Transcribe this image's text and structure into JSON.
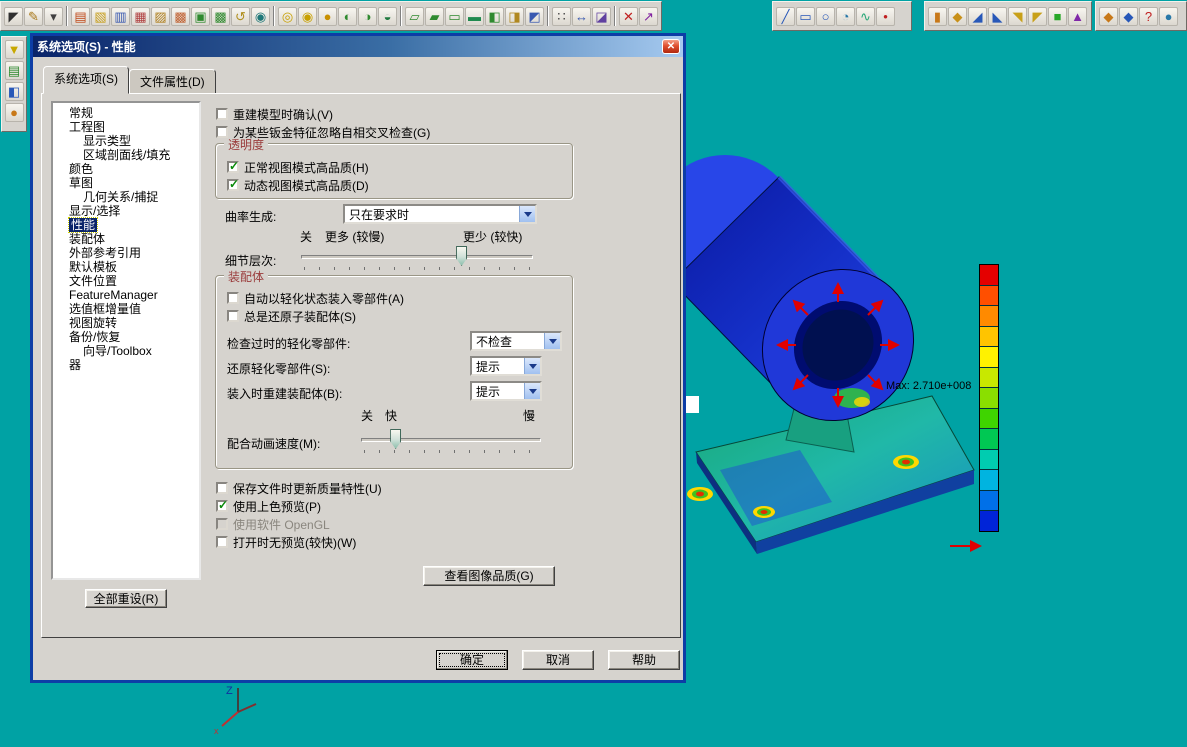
{
  "window": {
    "title": "系统选项(S)  -  性能",
    "close_glyph": "✕"
  },
  "tabs": {
    "system_options": "系统选项(S)",
    "document_properties": "文件属性(D)"
  },
  "tree": {
    "items": [
      {
        "label": "常规"
      },
      {
        "label": "工程图"
      },
      {
        "label": "显示类型"
      },
      {
        "label": "区域剖面线/填充"
      },
      {
        "label": "颜色"
      },
      {
        "label": "草图"
      },
      {
        "label": "几何关系/捕捉"
      },
      {
        "label": "显示/选择"
      },
      {
        "label": "性能"
      },
      {
        "label": "装配体"
      },
      {
        "label": "外部参考引用"
      },
      {
        "label": "默认模板"
      },
      {
        "label": "文件位置"
      },
      {
        "label": "FeatureManager"
      },
      {
        "label": "选值框增量值"
      },
      {
        "label": "视图旋转"
      },
      {
        "label": "备份/恢复"
      },
      {
        "label": "向导/Toolbox"
      },
      {
        "label": "器"
      }
    ]
  },
  "options": {
    "confirm_rebuild": "重建模型时确认(V)",
    "sheet_metal_check": "为某些钣金特征忽略自相交叉检查(G)",
    "transparency_group": "透明度",
    "normal_view_hq": "正常视图模式高品质(H)",
    "dynamic_view_hq": "动态视图模式高品质(D)",
    "curvature_label": "曲率生成:",
    "curvature_value": "只在要求时",
    "off1": "关",
    "more_slower": "更多 (较慢)",
    "less_faster": "更少 (较快)",
    "detail_level_label": "细节层次:",
    "assembly_group": "装配体",
    "auto_lightweight": "自动以轻化状态装入零部件(A)",
    "always_resolve_sub": "总是还原子装配体(S)",
    "check_outdated_label": "检查过时的轻化零部件:",
    "check_outdated_value": "不检查",
    "resolve_lightweight_label": "还原轻化零部件(S):",
    "resolve_lightweight_value": "提示",
    "rebuild_on_load_label": "装入时重建装配体(B):",
    "rebuild_on_load_value": "提示",
    "off2": "关",
    "fast": "快",
    "slow": "慢",
    "mate_speed_label": "配合动画速度(M):",
    "update_mass_props": "保存文件时更新质量特性(U)",
    "shaded_preview": "使用上色预览(P)",
    "software_opengl": "使用软件 OpenGL",
    "no_preview_open": "打开时无预览(较快)(W)",
    "image_quality_button": "查看图像品质(G)",
    "reset_all_button": "全部重设(R)",
    "states": {
      "confirm_rebuild": false,
      "sheet_metal_check": false,
      "normal_view_hq": true,
      "dynamic_view_hq": true,
      "auto_lightweight": false,
      "always_resolve_sub": false,
      "update_mass_props": false,
      "shaded_preview": true,
      "software_opengl": false,
      "no_preview_open": false
    },
    "detail_slider_percent": 69,
    "mate_slider_percent": 19
  },
  "footer": {
    "ok": "确定",
    "cancel": "取消",
    "help": "帮助"
  },
  "viewport": {
    "max_label": "Max: 2.710e+008",
    "legend_colors": [
      "#e40000",
      "#ff4f00",
      "#ff8a00",
      "#ffc400",
      "#fff200",
      "#c8e800",
      "#8adf00",
      "#3fd400",
      "#00c853",
      "#00ccb0",
      "#00b4e0",
      "#0070e8",
      "#0024d8"
    ],
    "triad_z": "Z",
    "triad_x": "x"
  },
  "toolbars": {
    "main": [
      {
        "name": "select-arrow-icon",
        "glyph": "◤",
        "color": "#303030"
      },
      {
        "name": "sketch-icon",
        "glyph": "✎",
        "color": "#a87818"
      },
      {
        "name": "sketch-flyout-arrow-icon",
        "glyph": "▾",
        "color": "#404040"
      },
      {
        "sep": true
      },
      {
        "name": "new-document-icon",
        "glyph": "▤",
        "color": "#c04818"
      },
      {
        "name": "open-document-icon",
        "glyph": "▧",
        "color": "#c8a020"
      },
      {
        "name": "save-icon",
        "glyph": "▥",
        "color": "#3858b0"
      },
      {
        "name": "print-icon",
        "glyph": "▦",
        "color": "#b04040"
      },
      {
        "name": "print-preview-icon",
        "glyph": "▨",
        "color": "#b08020"
      },
      {
        "name": "cut-icon",
        "glyph": "▩",
        "color": "#c06030"
      },
      {
        "name": "copy-icon",
        "glyph": "▣",
        "color": "#2f8a2f"
      },
      {
        "name": "paste-icon",
        "glyph": "▩",
        "color": "#2f8a2f"
      },
      {
        "name": "undo-icon",
        "glyph": "↺",
        "color": "#b09020"
      },
      {
        "name": "rebuild-icon",
        "glyph": "◉",
        "color": "#1f7878"
      },
      {
        "sep": true
      },
      {
        "name": "zoom-to-fit-icon",
        "glyph": "◎",
        "color": "#c8a000"
      },
      {
        "name": "zoom-to-area-icon",
        "glyph": "◉",
        "color": "#c8a000"
      },
      {
        "name": "zoom-in-out-icon",
        "glyph": "●",
        "color": "#c89000"
      },
      {
        "name": "rotate-view-icon",
        "glyph": "◐",
        "color": "#2f8a2f"
      },
      {
        "name": "pan-view-icon",
        "glyph": "◑",
        "color": "#2f8a2f"
      },
      {
        "name": "previous-view-icon",
        "glyph": "◒",
        "color": "#1f7a3f"
      },
      {
        "sep": true
      },
      {
        "name": "wireframe-icon",
        "glyph": "▱",
        "color": "#2f8a2f"
      },
      {
        "name": "hidden-lines-visible-icon",
        "glyph": "▰",
        "color": "#2f8a2f"
      },
      {
        "name": "hidden-lines-removed-icon",
        "glyph": "▭",
        "color": "#2f8a2f"
      },
      {
        "name": "shaded-icon",
        "glyph": "▬",
        "color": "#1f8a4f"
      },
      {
        "name": "section-view-icon",
        "glyph": "◧",
        "color": "#2f8a2f"
      },
      {
        "name": "perspective-icon",
        "glyph": "◨",
        "color": "#b08820"
      },
      {
        "name": "standard-views-icon",
        "glyph": "◩",
        "color": "#3858b0"
      },
      {
        "sep": true
      },
      {
        "name": "grid-icon",
        "glyph": "∷",
        "color": "#404040"
      },
      {
        "name": "dimension-icon",
        "glyph": "↔",
        "color": "#3858b0"
      },
      {
        "name": "annotation-icon",
        "glyph": "◪",
        "color": "#6040a0"
      },
      {
        "sep": true
      },
      {
        "name": "delete-icon",
        "glyph": "✕",
        "color": "#c02020"
      },
      {
        "name": "measure-tool-icon",
        "glyph": "↗",
        "color": "#8020a0"
      }
    ],
    "sketch": [
      {
        "name": "sketch-line-icon",
        "glyph": "╱",
        "color": "#2858b8"
      },
      {
        "name": "sketch-rectangle-icon",
        "glyph": "▭",
        "color": "#2858b8"
      },
      {
        "name": "sketch-circle-icon",
        "glyph": "○",
        "color": "#2858b8"
      },
      {
        "name": "sketch-arc-icon",
        "glyph": "◔",
        "color": "#2878a8"
      },
      {
        "name": "sketch-spline-icon",
        "glyph": "∿",
        "color": "#28a878"
      },
      {
        "name": "sketch-point-icon",
        "glyph": "•",
        "color": "#c02020"
      }
    ],
    "features": [
      {
        "name": "extruded-boss-icon",
        "glyph": "▮",
        "color": "#c87818"
      },
      {
        "name": "revolved-boss-icon",
        "glyph": "◆",
        "color": "#c89018"
      },
      {
        "name": "extruded-cut-icon",
        "glyph": "◢",
        "color": "#2858b8"
      },
      {
        "name": "revolved-cut-icon",
        "glyph": "◣",
        "color": "#2858b8"
      },
      {
        "name": "fillet-icon",
        "glyph": "◥",
        "color": "#c8a018"
      },
      {
        "name": "chamfer-icon",
        "glyph": "◤",
        "color": "#c8a018"
      },
      {
        "name": "shell-icon",
        "glyph": "■",
        "color": "#28a828"
      },
      {
        "name": "pattern-icon",
        "glyph": "▲",
        "color": "#8028a8"
      }
    ],
    "right": [
      {
        "name": "simulation-icon",
        "glyph": "◆",
        "color": "#c87818"
      },
      {
        "name": "toolbox-icon",
        "glyph": "◆",
        "color": "#2858b8"
      },
      {
        "name": "help-icon",
        "glyph": "?",
        "color": "#c02020"
      },
      {
        "name": "options-icon",
        "glyph": "●",
        "color": "#2878a8"
      }
    ],
    "side": [
      {
        "name": "filter-icon",
        "glyph": "▼",
        "color": "#c8a800"
      },
      {
        "name": "display-pane-icon",
        "glyph": "▤",
        "color": "#2f8a2f"
      },
      {
        "name": "hide-show-icon",
        "glyph": "◧",
        "color": "#2858b8"
      },
      {
        "name": "appearance-icon",
        "glyph": "●",
        "color": "#c87818"
      }
    ]
  }
}
